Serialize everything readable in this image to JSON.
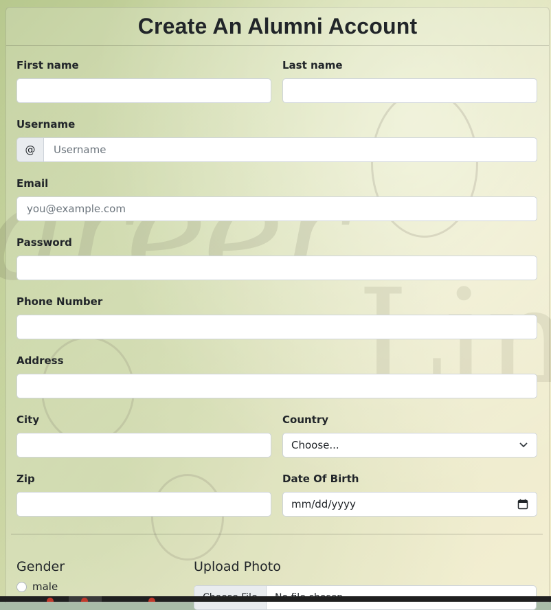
{
  "form": {
    "title": "Create An Alumni Account",
    "first_name": {
      "label": "First name",
      "value": ""
    },
    "last_name": {
      "label": "Last name",
      "value": ""
    },
    "username": {
      "label": "Username",
      "addon": "@",
      "placeholder": "Username"
    },
    "email": {
      "label": "Email",
      "placeholder": "you@example.com"
    },
    "password": {
      "label": "Password",
      "value": ""
    },
    "phone": {
      "label": "Phone Number",
      "value": ""
    },
    "address": {
      "label": "Address",
      "value": ""
    },
    "city": {
      "label": "City",
      "value": ""
    },
    "country": {
      "label": "Country",
      "selected": "Choose..."
    },
    "zip": {
      "label": "Zip",
      "value": ""
    },
    "dob": {
      "label": "Date Of Birth",
      "placeholder": "mm/dd/yyyy"
    },
    "gender": {
      "label": "Gender",
      "options": [
        "male"
      ]
    },
    "photo": {
      "label": "Upload Photo",
      "button": "Choose File",
      "file_status": "No file chosen"
    }
  },
  "icons": {
    "select_caret": "chevron-down-icon",
    "calendar": "calendar-icon"
  },
  "colors": {
    "background_tint": "#cfd9a8",
    "text": "#212529",
    "border": "#ced4da",
    "addon_bg": "#e9ecef"
  }
}
